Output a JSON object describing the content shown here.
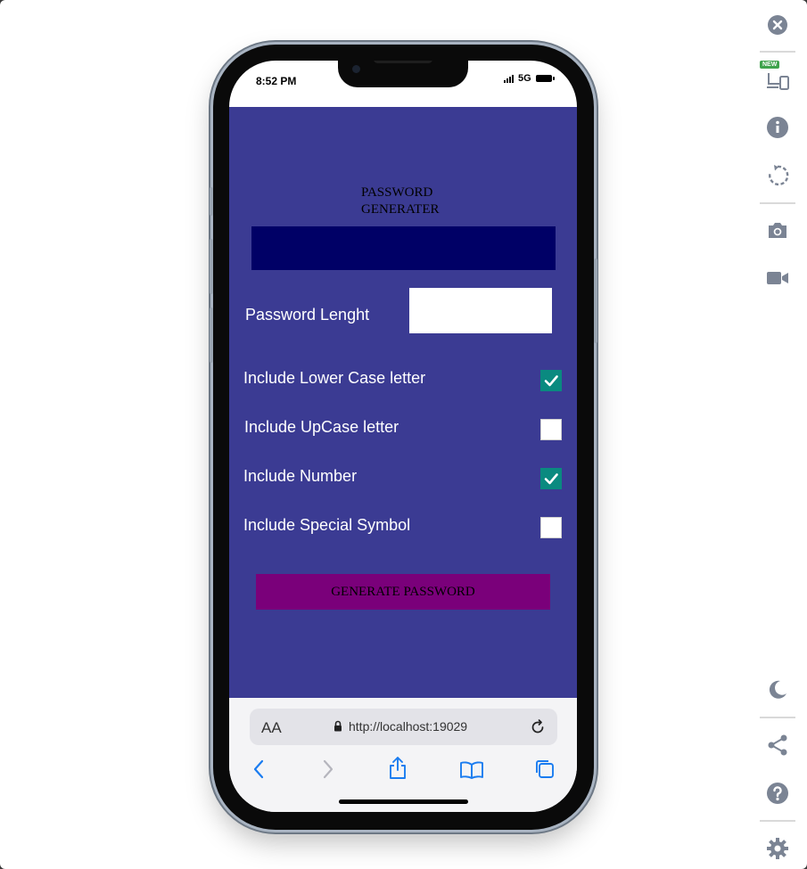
{
  "status_bar": {
    "time": "8:52 PM",
    "network": "5G"
  },
  "app": {
    "title": "PASSWORD GENERATER",
    "password_output": "",
    "length_label": "Password Lenght",
    "length_value": "",
    "options": [
      {
        "label": "Include Lower Case letter",
        "checked": true
      },
      {
        "label": "Include UpCase letter",
        "checked": false
      },
      {
        "label": "Include Number",
        "checked": true
      },
      {
        "label": "Include Special Symbol",
        "checked": false
      }
    ],
    "generate_button": "GENERATE PASSWORD"
  },
  "browser": {
    "text_size_label": "AA",
    "url": "http://localhost:19029"
  },
  "toolbar": {
    "new_badge": "NEW"
  },
  "colors": {
    "app_background": "#3b3b93",
    "output_box": "#000066",
    "generate_button": "#7a007a",
    "checkbox_checked": "#0a8a80",
    "toolbar_icon": "#7b8494"
  }
}
